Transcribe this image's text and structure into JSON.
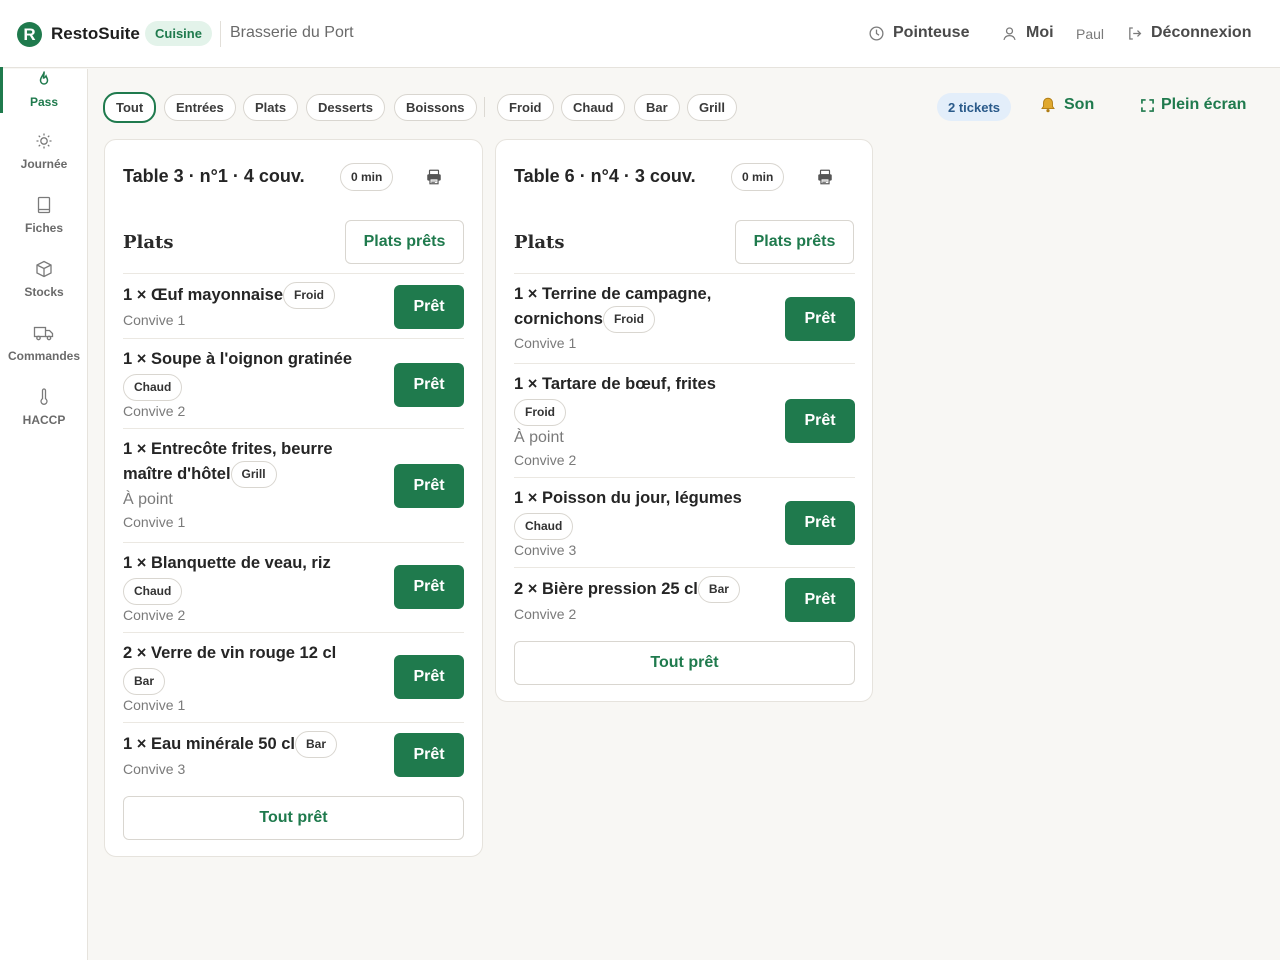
{
  "header": {
    "logo_letter": "R",
    "brand": "RestoSuite",
    "module": "Cuisine",
    "establishment": "Brasserie du Port",
    "clock_label": "Pointeuse",
    "me_label": "Moi",
    "username": "Paul",
    "logout_label": "Déconnexion"
  },
  "sidebar": {
    "items": [
      {
        "label": "Pass",
        "icon": "flame-icon"
      },
      {
        "label": "Journée",
        "icon": "sun-icon"
      },
      {
        "label": "Fiches",
        "icon": "book-icon"
      },
      {
        "label": "Stocks",
        "icon": "box-icon"
      },
      {
        "label": "Commandes",
        "icon": "truck-icon"
      },
      {
        "label": "HACCP",
        "icon": "thermometer-icon"
      }
    ]
  },
  "filters": {
    "courses": [
      "Tout",
      "Entrées",
      "Plats",
      "Desserts",
      "Boissons"
    ],
    "stations": [
      "Froid",
      "Chaud",
      "Bar",
      "Grill"
    ],
    "active": "Tout",
    "tickets_count": "2 tickets",
    "sound_label": "Son",
    "fullscreen_label": "Plein écran"
  },
  "tickets": [
    {
      "title": "Table 3 · n°1 · 4 couv.",
      "timer": "0 min",
      "section_title": "Plats",
      "section_button": "Plats prêts",
      "items": [
        {
          "name": "1 × Œuf mayonnaise",
          "tag": "Froid",
          "note": "",
          "guest": "Convive 1",
          "button": "Prêt"
        },
        {
          "name": "1 × Soupe à l'oignon gratinée",
          "tag": "Chaud",
          "note": "",
          "guest": "Convive 2",
          "button": "Prêt"
        },
        {
          "name_line1": "1 × Entrecôte frites, beurre",
          "name_line2": "maître d'hôtel",
          "tag": "Grill",
          "note": "À point",
          "guest": "Convive 1",
          "button": "Prêt"
        },
        {
          "name": "1 × Blanquette de veau, riz",
          "tag": "Chaud",
          "note": "",
          "guest": "Convive 2",
          "button": "Prêt"
        },
        {
          "name": "2 × Verre de vin rouge 12 cl",
          "tag": "Bar",
          "note": "",
          "guest": "Convive 1",
          "button": "Prêt"
        },
        {
          "name": "1 × Eau minérale 50 cl",
          "tag": "Bar",
          "note": "",
          "guest": "Convive 3",
          "button": "Prêt"
        }
      ],
      "all_ready": "Tout prêt"
    },
    {
      "title": "Table 6 · n°4 · 3 couv.",
      "timer": "0 min",
      "section_title": "Plats",
      "section_button": "Plats prêts",
      "items": [
        {
          "name_line1": "1 × Terrine de campagne,",
          "name_line2": "cornichons",
          "tag": "Froid",
          "note": "",
          "guest": "Convive 1",
          "button": "Prêt"
        },
        {
          "name": "1 × Tartare de bœuf, frites",
          "tag": "Froid",
          "note": "À point",
          "guest": "Convive 2",
          "button": "Prêt"
        },
        {
          "name": "1 × Poisson du jour, légumes",
          "tag": "Chaud",
          "note": "",
          "guest": "Convive 3",
          "button": "Prêt"
        },
        {
          "name": "2 × Bière pression 25 cl",
          "tag": "Bar",
          "note": "",
          "guest": "Convive 2",
          "button": "Prêt"
        }
      ],
      "all_ready": "Tout prêt"
    }
  ],
  "colors": {
    "accent": "#1f7a4d",
    "background": "#f8f7f4",
    "tickets_badge_bg": "#e3eefa"
  }
}
